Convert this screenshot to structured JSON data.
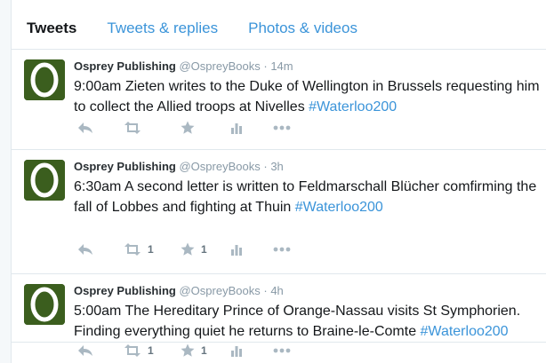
{
  "tabs": [
    {
      "label": "Tweets",
      "active": true
    },
    {
      "label": "Tweets & replies",
      "active": false
    },
    {
      "label": "Photos & videos",
      "active": false
    }
  ],
  "avatar": {
    "letter": "O",
    "bg": "#3b5e1e"
  },
  "tweets": [
    {
      "name": "Osprey Publishing",
      "handle": "@OspreyBooks",
      "dot": "·",
      "time": "14m",
      "text": "9:00am Zieten writes to the Duke of Wellington in Brussels requesting him to collect the Allied troops at Nivelles ",
      "hashtag": "#Waterloo200",
      "retweets": "",
      "favorites": ""
    },
    {
      "name": "Osprey Publishing",
      "handle": "@OspreyBooks",
      "dot": "·",
      "time": "3h",
      "text": "6:30am A second letter is written to Feldmarschall Blücher comfirming the fall of Lobbes and fighting at Thuin ",
      "hashtag": "#Waterloo200",
      "retweets": "1",
      "favorites": "1"
    },
    {
      "name": "Osprey Publishing",
      "handle": "@OspreyBooks",
      "dot": "·",
      "time": "4h",
      "text": "5:00am The Hereditary Prince of Orange-Nassau visits St Symphorien. Finding everything quiet he returns to Braine-le-Comte ",
      "hashtag": "#Waterloo200",
      "retweets": "1",
      "favorites": "1"
    }
  ],
  "colors": {
    "link": "#3b94d9",
    "icon": "#aab8c2",
    "border": "#e1e8ed"
  }
}
